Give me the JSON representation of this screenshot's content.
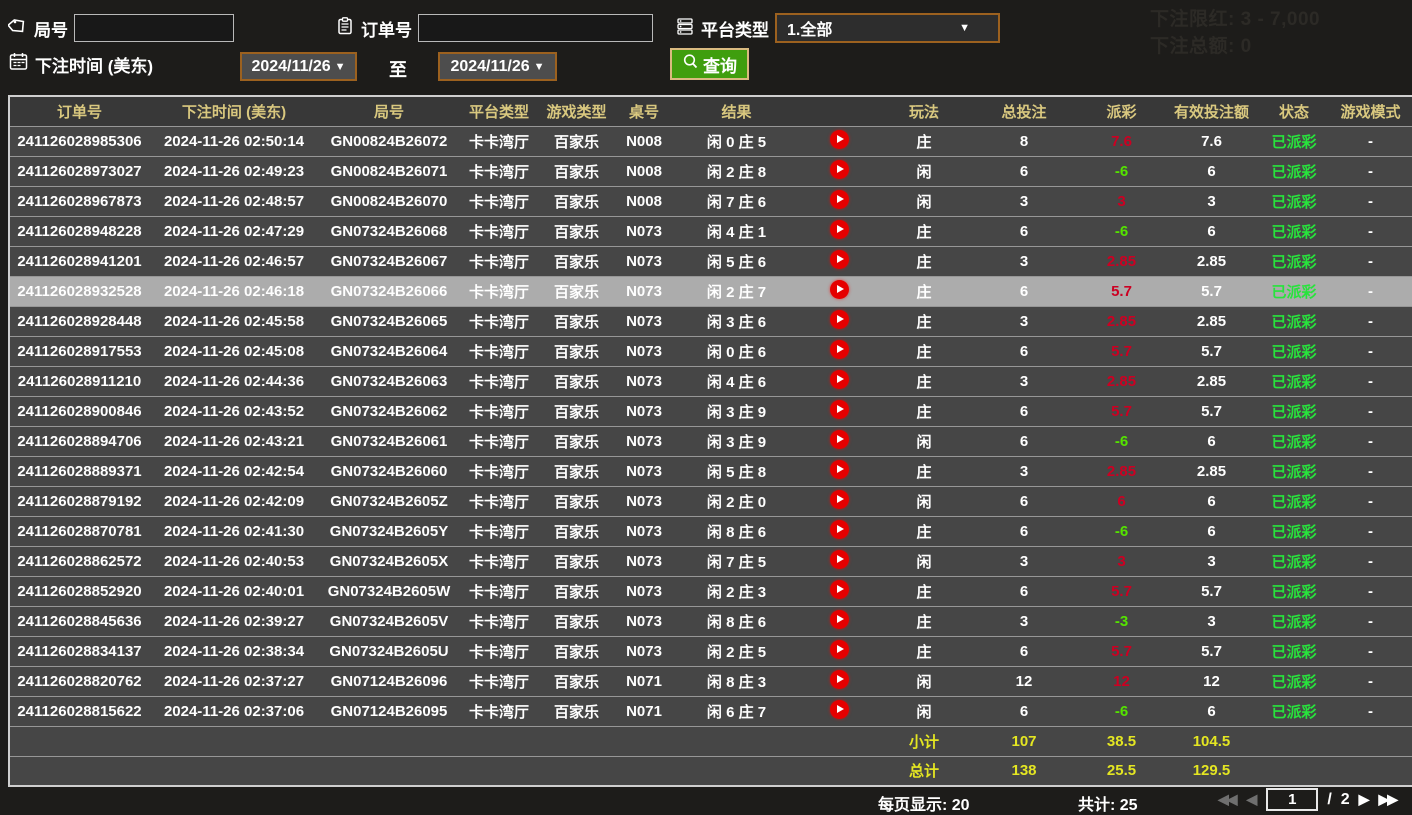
{
  "colors": {
    "page_bg": "#1d1c1a",
    "header_text": "#d9c87f",
    "row_bg": "#464646",
    "highlight_row_bg": "#acacac",
    "payout_positive": "#cc0022",
    "payout_negative": "#54e400",
    "status_green": "#27e43c",
    "totals_yellow": "#e4e622",
    "query_button_green": "#3f9e0e",
    "select_border_orange": "#9c611f"
  },
  "background_hint": {
    "line1": "下注限红: 3 - 7,000",
    "line2": "下注总额: 0"
  },
  "filters": {
    "game_no_label": "局号",
    "order_no_label": "订单号",
    "platform_label": "平台类型",
    "platform_value": "1.全部",
    "bet_time_label": "下注时间 (美东)",
    "date_from": "2024/11/26",
    "date_to": "2024/11/26",
    "to_label": "至",
    "query_label": "查询",
    "caret": "▼"
  },
  "table": {
    "headers": [
      "订单号",
      "下注时间 (美东)",
      "局号",
      "平台类型",
      "游戏类型",
      "桌号",
      "结果",
      "",
      "玩法",
      "总投注",
      "派彩",
      "有效投注额",
      "状态",
      "游戏模式"
    ],
    "rows": [
      {
        "order_no": "241126028985306",
        "bet_time": "2024-11-26 02:50:14",
        "game_no": "GN00824B26072",
        "platform": "卡卡湾厅",
        "game_type": "百家乐",
        "table_no": "N008",
        "result": "闲 0 庄 5",
        "bet_on": "庄",
        "total_bet": "8",
        "payout": "7.6",
        "valid_bet": "7.6",
        "status": "已派彩",
        "mode": "-",
        "highlighted": false
      },
      {
        "order_no": "241126028973027",
        "bet_time": "2024-11-26 02:49:23",
        "game_no": "GN00824B26071",
        "platform": "卡卡湾厅",
        "game_type": "百家乐",
        "table_no": "N008",
        "result": "闲 2 庄 8",
        "bet_on": "闲",
        "total_bet": "6",
        "payout": "-6",
        "valid_bet": "6",
        "status": "已派彩",
        "mode": "-",
        "highlighted": false
      },
      {
        "order_no": "241126028967873",
        "bet_time": "2024-11-26 02:48:57",
        "game_no": "GN00824B26070",
        "platform": "卡卡湾厅",
        "game_type": "百家乐",
        "table_no": "N008",
        "result": "闲 7 庄 6",
        "bet_on": "闲",
        "total_bet": "3",
        "payout": "3",
        "valid_bet": "3",
        "status": "已派彩",
        "mode": "-",
        "highlighted": false
      },
      {
        "order_no": "241126028948228",
        "bet_time": "2024-11-26 02:47:29",
        "game_no": "GN07324B26068",
        "platform": "卡卡湾厅",
        "game_type": "百家乐",
        "table_no": "N073",
        "result": "闲 4 庄 1",
        "bet_on": "庄",
        "total_bet": "6",
        "payout": "-6",
        "valid_bet": "6",
        "status": "已派彩",
        "mode": "-",
        "highlighted": false
      },
      {
        "order_no": "241126028941201",
        "bet_time": "2024-11-26 02:46:57",
        "game_no": "GN07324B26067",
        "platform": "卡卡湾厅",
        "game_type": "百家乐",
        "table_no": "N073",
        "result": "闲 5 庄 6",
        "bet_on": "庄",
        "total_bet": "3",
        "payout": "2.85",
        "valid_bet": "2.85",
        "status": "已派彩",
        "mode": "-",
        "highlighted": false
      },
      {
        "order_no": "241126028932528",
        "bet_time": "2024-11-26 02:46:18",
        "game_no": "GN07324B26066",
        "platform": "卡卡湾厅",
        "game_type": "百家乐",
        "table_no": "N073",
        "result": "闲 2 庄 7",
        "bet_on": "庄",
        "total_bet": "6",
        "payout": "5.7",
        "valid_bet": "5.7",
        "status": "已派彩",
        "mode": "-",
        "highlighted": true
      },
      {
        "order_no": "241126028928448",
        "bet_time": "2024-11-26 02:45:58",
        "game_no": "GN07324B26065",
        "platform": "卡卡湾厅",
        "game_type": "百家乐",
        "table_no": "N073",
        "result": "闲 3 庄 6",
        "bet_on": "庄",
        "total_bet": "3",
        "payout": "2.85",
        "valid_bet": "2.85",
        "status": "已派彩",
        "mode": "-",
        "highlighted": false
      },
      {
        "order_no": "241126028917553",
        "bet_time": "2024-11-26 02:45:08",
        "game_no": "GN07324B26064",
        "platform": "卡卡湾厅",
        "game_type": "百家乐",
        "table_no": "N073",
        "result": "闲 0 庄 6",
        "bet_on": "庄",
        "total_bet": "6",
        "payout": "5.7",
        "valid_bet": "5.7",
        "status": "已派彩",
        "mode": "-",
        "highlighted": false
      },
      {
        "order_no": "241126028911210",
        "bet_time": "2024-11-26 02:44:36",
        "game_no": "GN07324B26063",
        "platform": "卡卡湾厅",
        "game_type": "百家乐",
        "table_no": "N073",
        "result": "闲 4 庄 6",
        "bet_on": "庄",
        "total_bet": "3",
        "payout": "2.85",
        "valid_bet": "2.85",
        "status": "已派彩",
        "mode": "-",
        "highlighted": false
      },
      {
        "order_no": "241126028900846",
        "bet_time": "2024-11-26 02:43:52",
        "game_no": "GN07324B26062",
        "platform": "卡卡湾厅",
        "game_type": "百家乐",
        "table_no": "N073",
        "result": "闲 3 庄 9",
        "bet_on": "庄",
        "total_bet": "6",
        "payout": "5.7",
        "valid_bet": "5.7",
        "status": "已派彩",
        "mode": "-",
        "highlighted": false
      },
      {
        "order_no": "241126028894706",
        "bet_time": "2024-11-26 02:43:21",
        "game_no": "GN07324B26061",
        "platform": "卡卡湾厅",
        "game_type": "百家乐",
        "table_no": "N073",
        "result": "闲 3 庄 9",
        "bet_on": "闲",
        "total_bet": "6",
        "payout": "-6",
        "valid_bet": "6",
        "status": "已派彩",
        "mode": "-",
        "highlighted": false
      },
      {
        "order_no": "241126028889371",
        "bet_time": "2024-11-26 02:42:54",
        "game_no": "GN07324B26060",
        "platform": "卡卡湾厅",
        "game_type": "百家乐",
        "table_no": "N073",
        "result": "闲 5 庄 8",
        "bet_on": "庄",
        "total_bet": "3",
        "payout": "2.85",
        "valid_bet": "2.85",
        "status": "已派彩",
        "mode": "-",
        "highlighted": false
      },
      {
        "order_no": "241126028879192",
        "bet_time": "2024-11-26 02:42:09",
        "game_no": "GN07324B2605Z",
        "platform": "卡卡湾厅",
        "game_type": "百家乐",
        "table_no": "N073",
        "result": "闲 2 庄 0",
        "bet_on": "闲",
        "total_bet": "6",
        "payout": "6",
        "valid_bet": "6",
        "status": "已派彩",
        "mode": "-",
        "highlighted": false
      },
      {
        "order_no": "241126028870781",
        "bet_time": "2024-11-26 02:41:30",
        "game_no": "GN07324B2605Y",
        "platform": "卡卡湾厅",
        "game_type": "百家乐",
        "table_no": "N073",
        "result": "闲 8 庄 6",
        "bet_on": "庄",
        "total_bet": "6",
        "payout": "-6",
        "valid_bet": "6",
        "status": "已派彩",
        "mode": "-",
        "highlighted": false
      },
      {
        "order_no": "241126028862572",
        "bet_time": "2024-11-26 02:40:53",
        "game_no": "GN07324B2605X",
        "platform": "卡卡湾厅",
        "game_type": "百家乐",
        "table_no": "N073",
        "result": "闲 7 庄 5",
        "bet_on": "闲",
        "total_bet": "3",
        "payout": "3",
        "valid_bet": "3",
        "status": "已派彩",
        "mode": "-",
        "highlighted": false
      },
      {
        "order_no": "241126028852920",
        "bet_time": "2024-11-26 02:40:01",
        "game_no": "GN07324B2605W",
        "platform": "卡卡湾厅",
        "game_type": "百家乐",
        "table_no": "N073",
        "result": "闲 2 庄 3",
        "bet_on": "庄",
        "total_bet": "6",
        "payout": "5.7",
        "valid_bet": "5.7",
        "status": "已派彩",
        "mode": "-",
        "highlighted": false
      },
      {
        "order_no": "241126028845636",
        "bet_time": "2024-11-26 02:39:27",
        "game_no": "GN07324B2605V",
        "platform": "卡卡湾厅",
        "game_type": "百家乐",
        "table_no": "N073",
        "result": "闲 8 庄 6",
        "bet_on": "庄",
        "total_bet": "3",
        "payout": "-3",
        "valid_bet": "3",
        "status": "已派彩",
        "mode": "-",
        "highlighted": false
      },
      {
        "order_no": "241126028834137",
        "bet_time": "2024-11-26 02:38:34",
        "game_no": "GN07324B2605U",
        "platform": "卡卡湾厅",
        "game_type": "百家乐",
        "table_no": "N073",
        "result": "闲 2 庄 5",
        "bet_on": "庄",
        "total_bet": "6",
        "payout": "5.7",
        "valid_bet": "5.7",
        "status": "已派彩",
        "mode": "-",
        "highlighted": false
      },
      {
        "order_no": "241126028820762",
        "bet_time": "2024-11-26 02:37:27",
        "game_no": "GN07124B26096",
        "platform": "卡卡湾厅",
        "game_type": "百家乐",
        "table_no": "N071",
        "result": "闲 8 庄 3",
        "bet_on": "闲",
        "total_bet": "12",
        "payout": "12",
        "valid_bet": "12",
        "status": "已派彩",
        "mode": "-",
        "highlighted": false
      },
      {
        "order_no": "241126028815622",
        "bet_time": "2024-11-26 02:37:06",
        "game_no": "GN07124B26095",
        "platform": "卡卡湾厅",
        "game_type": "百家乐",
        "table_no": "N071",
        "result": "闲 6 庄 7",
        "bet_on": "闲",
        "total_bet": "6",
        "payout": "-6",
        "valid_bet": "6",
        "status": "已派彩",
        "mode": "-",
        "highlighted": false
      }
    ],
    "subtotal": {
      "label": "小计",
      "total_bet": "107",
      "payout": "38.5",
      "valid_bet": "104.5"
    },
    "grand_total": {
      "label": "总计",
      "total_bet": "138",
      "payout": "25.5",
      "valid_bet": "129.5"
    }
  },
  "footer": {
    "per_page": "每页显示: 20",
    "total_count": "共计: 25",
    "first_icon": "◀◀",
    "prev_icon": "◀",
    "current_page": "1",
    "page_sep": "/",
    "total_pages": "2",
    "next_icon": "▶",
    "last_icon": "▶▶"
  }
}
